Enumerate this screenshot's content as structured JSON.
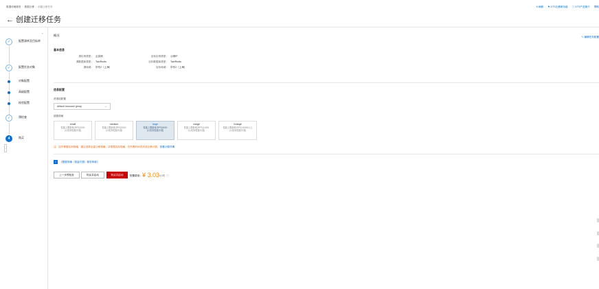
{
  "breadcrumb": {
    "items": [
      "数据传输服务",
      "数据迁移",
      "创建迁移任务"
    ]
  },
  "toplinks": [
    "⟲ 刷新",
    "⚑ DTS迁移新功能",
    "ⓘ DTS产品简介",
    "帮助"
  ],
  "page": {
    "back_glyph": "←",
    "title": "创建迁移任务"
  },
  "steps": {
    "collapse_glyph": "«",
    "items": [
      {
        "label": "配置源库及目标库",
        "state": "done"
      },
      {
        "label": "配置任务对象",
        "state": "done"
      },
      {
        "label": "对象配置",
        "state": "sub"
      },
      {
        "label": "高级配置",
        "state": "sub"
      },
      {
        "label": "校验配置",
        "state": "sub"
      },
      {
        "label": "预检查",
        "state": "done"
      },
      {
        "label": "购买",
        "state": "current",
        "number": "4"
      }
    ],
    "done_glyph": "✓",
    "handle_glyph": "›"
  },
  "overview": {
    "title": "概况",
    "edit_link": "✎ 编辑任务配置",
    "basic_title": "基本信息",
    "rows": [
      {
        "k1": "源实例类型：",
        "v1": "云实例",
        "k2": "目标实例类型：",
        "v2": "公网IP"
      },
      {
        "k1": "源数据库类型：",
        "v1": "Tair/Redis",
        "k2": "目标数据库类型：",
        "v2": "Tair/Redis"
      },
      {
        "k1": "源地域：",
        "v1": "华东2（上海）",
        "k2": "目标地域：",
        "v2": "华东2（上海）"
      }
    ]
  },
  "purchase": {
    "title": "信息配置",
    "resource_group_label": "资源组配置",
    "resource_group_value": "default resource group",
    "spec_label": "链路规格",
    "specs": [
      {
        "name": "small",
        "line1": "性能上限参考(RPS)2000",
        "line2": "(以实际性能为准)",
        "selected": false
      },
      {
        "name": "medium",
        "line1": "性能上限参考(RPS)5000",
        "line2": "(以实际性能为准)",
        "selected": false
      },
      {
        "name": "large",
        "line1": "性能上限参考(RPS)8000",
        "line2": "(以实际性能为准)",
        "selected": true
      },
      {
        "name": "xlarge",
        "line1": "性能上限参考(RPS)11000",
        "line2": "(以实际性能为准)",
        "selected": false
      },
      {
        "name": "2xlarge",
        "line1": "性能上限参考(RPS)15000以上",
        "line2": "(以实际性能为准)",
        "selected": false
      }
    ],
    "note": "注：如不需要实例规格，建议选择全量迁移规格，并根据实际规格，在所需时间内完成迁移计费，",
    "note_link": "查看计费详情",
    "agree_text": "《数据传输（按量付费）服务条款》",
    "agree_prefix": "",
    "buttons": {
      "prev": "上一步预检查",
      "buy": "购买并启动",
      "buy_start": "购买并启动"
    },
    "price_label": "配置费用：",
    "price_amount": "¥ 3.03",
    "price_unit": "/小时",
    "price_help": "ⓘ"
  }
}
